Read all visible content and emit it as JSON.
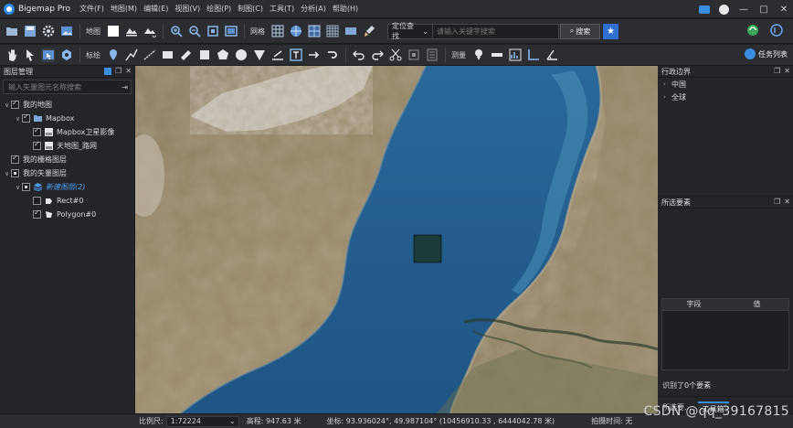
{
  "app": {
    "title": "Bigemap Pro",
    "menu": [
      "文件(F)",
      "地图(M)",
      "编辑(E)",
      "视图(V)",
      "绘图(P)",
      "制图(C)",
      "工具(T)",
      "分析(A)",
      "帮助(H)"
    ],
    "window_controls": [
      "—",
      "□",
      "✕"
    ]
  },
  "toolbar1": {
    "map_label": "地图",
    "grid_label": "网格",
    "locate_select": "定位查找",
    "search_placeholder": "请输入关键字搜索",
    "search_button": "搜索",
    "fav_icon": "★"
  },
  "toolbar2": {
    "label_label": "标绘",
    "measure_label": "测量",
    "task_list_label": "任务列表"
  },
  "left_panel": {
    "title": "图层管理",
    "search_placeholder": "输入矢量图元名称搜索",
    "tree": [
      {
        "label": "我的地图",
        "level": 0,
        "arrow": "∨",
        "check": "on",
        "icon": null
      },
      {
        "label": "Mapbox",
        "level": 1,
        "arrow": "∨",
        "check": "on",
        "icon": "folder"
      },
      {
        "label": "Mapbox卫星影像",
        "level": 2,
        "arrow": "",
        "check": "on",
        "icon": "layer"
      },
      {
        "label": "天地图_路网",
        "level": 2,
        "arrow": "",
        "check": "on",
        "icon": "layer"
      },
      {
        "label": "我的栅格图层",
        "level": 0,
        "arrow": "",
        "check": "on",
        "icon": null
      },
      {
        "label": "我的矢量图层",
        "level": 0,
        "arrow": "∨",
        "check": "partial",
        "icon": null
      },
      {
        "label": "新建图层(2)",
        "level": 1,
        "arrow": "∨",
        "check": "partial",
        "icon": "stack",
        "style": "italic-blue"
      },
      {
        "label": "Rect#0",
        "level": 2,
        "arrow": "",
        "check": "off",
        "icon": "rect"
      },
      {
        "label": "Polygon#0",
        "level": 2,
        "arrow": "",
        "check": "on",
        "icon": "polygon"
      }
    ]
  },
  "right_panel": {
    "admin_title": "行政边界",
    "admin_items": [
      "中国",
      "全球"
    ],
    "selected_title": "所选要素",
    "columns": [
      "字段",
      "值"
    ],
    "selected_count": "识别了0个要素",
    "tabs": [
      "所选要...",
      "工具箱"
    ]
  },
  "statusbar": {
    "scale_label": "比例尺:",
    "scale_value": "1:72224",
    "elevation": "高程: 947.63 米",
    "coords": "坐标: 93.936024°, 49.987104°  (10456910.33 , 6444042.78 米)",
    "shoot_time": "拍摄时间: 无"
  },
  "watermark": "CSDN @qq_39167815",
  "colors": {
    "accent": "#3b8de0",
    "panel_bg": "#242529",
    "toolbar_bg": "#2b2d31",
    "lake": "#235a88"
  }
}
